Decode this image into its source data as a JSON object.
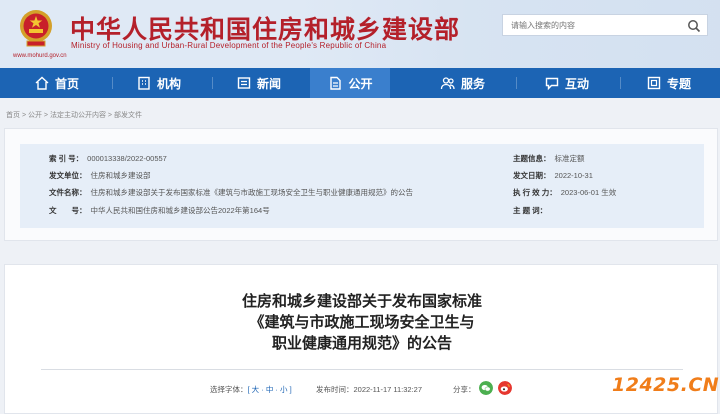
{
  "header": {
    "title": "中华人民共和国住房和城乡建设部",
    "subtitle": "Ministry of Housing and Urban-Rural Development of the People's Republic of China",
    "url": "www.mohurd.gov.cn",
    "search_placeholder": "请输入搜索的内容"
  },
  "nav": {
    "items": [
      {
        "label": "首页",
        "icon": "home-icon"
      },
      {
        "label": "机构",
        "icon": "building-icon"
      },
      {
        "label": "新闻",
        "icon": "news-icon"
      },
      {
        "label": "公开",
        "icon": "document-icon"
      },
      {
        "label": "服务",
        "icon": "people-icon"
      },
      {
        "label": "互动",
        "icon": "chat-icon"
      },
      {
        "label": "专题",
        "icon": "topic-icon"
      }
    ],
    "active": "公开"
  },
  "breadcrumb": [
    "首页",
    "公开",
    "法定主动公开内容",
    "部发文件"
  ],
  "info": {
    "index_label": "索 引 号：",
    "index_value": "000013338/2022-00557",
    "issuer_label": "发文单位：",
    "issuer_value": "住房和城乡建设部",
    "name_label": "文件名称：",
    "name_value": "住房和城乡建设部关于发布国家标准《建筑与市政施工现场安全卫生与职业健康通用规范》的公告",
    "docno_label": "文　　号：",
    "docno_value": "中华人民共和国住房和城乡建设部公告2022年第164号",
    "category_label": "主题信息：",
    "category_value": "标准定额",
    "date_label": "发文日期：",
    "date_value": "2022-10-31",
    "effect_label": "执 行 效 力：",
    "effect_value": "2023-06-01 生效",
    "keywords_label": "主 题 词："
  },
  "article": {
    "title_line1": "住房和城乡建设部关于发布国家标准",
    "title_line2": "《建筑与市政施工现场安全卫生与",
    "title_line3": "职业健康通用规范》的公告",
    "font_label": "选择字体：",
    "font_sizes": "[ 大 · 中 · 小 ]",
    "publish_label": "发布时间：",
    "publish_value": "2022-11-17 11:32:27",
    "share_label": "分享：",
    "share_wechat": "wechat-icon",
    "share_weibo": "weibo-icon"
  },
  "watermark": "12425.CN"
}
